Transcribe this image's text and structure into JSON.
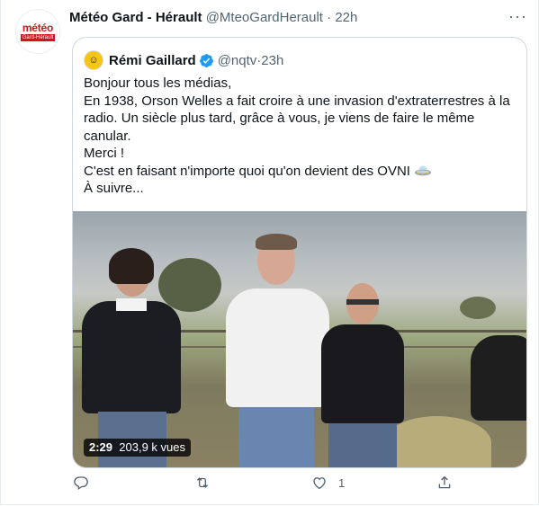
{
  "tweet": {
    "avatar_line1": "météo",
    "avatar_line2": "Gard-Hérault",
    "author_name": "Météo Gard - Hérault",
    "author_handle": "@MteoGardHerault",
    "separator": " · ",
    "time": "22h",
    "more_label": "···"
  },
  "quoted": {
    "author_name": "Rémi Gaillard",
    "author_handle": "@nqtv",
    "separator": " · ",
    "time": "23h",
    "lines": [
      "Bonjour tous les médias,",
      "En 1938, Orson Welles a fait croire à une invasion d'extraterrestres à la",
      "radio. Un siècle plus tard, grâce à vous, je viens de faire le même",
      "canular.",
      "Merci !",
      "C'est en faisant n'importe quoi qu'on devient des OVNI",
      "À suivre..."
    ],
    "video": {
      "duration": "2:29",
      "views": "203,9 k vues"
    }
  },
  "actions": {
    "reply_count": "",
    "retweet_count": "",
    "like_count": "1",
    "share_count": ""
  },
  "colors": {
    "accent": "#1d9bf0",
    "muted": "#536471",
    "brand_red": "#d0161b"
  }
}
